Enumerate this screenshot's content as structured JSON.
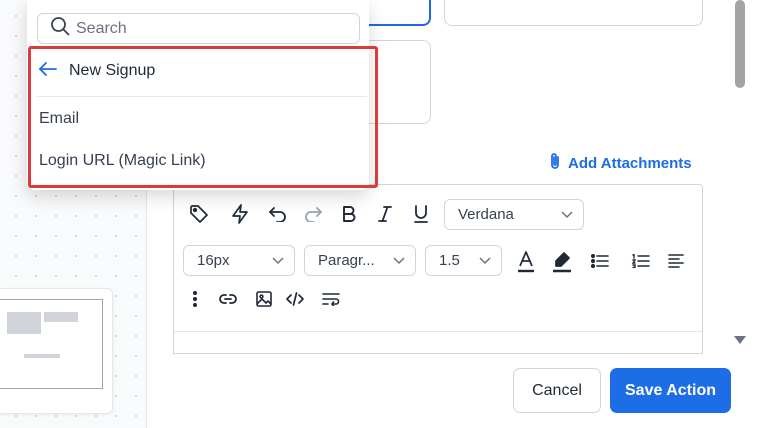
{
  "dropdown": {
    "search_placeholder": "Search",
    "back_label": "New Signup",
    "items": [
      {
        "label": "Email"
      },
      {
        "label": "Login URL (Magic Link)"
      }
    ]
  },
  "attachments": {
    "label": "Add Attachments"
  },
  "editor": {
    "font_family": "Verdana",
    "font_size": "16px",
    "block_format": "Paragr...",
    "line_height": "1.5",
    "tools_row1": [
      "tag-icon",
      "lightning-icon",
      "undo-icon",
      "redo-icon",
      "bold-icon",
      "italic-icon",
      "underline-icon"
    ],
    "tools_row2": [
      "text-color-icon",
      "highlight-icon",
      "bullet-list-icon",
      "numbered-list-icon",
      "align-left-icon"
    ],
    "tools_row3": [
      "more-vertical-icon",
      "link-icon",
      "image-icon",
      "code-icon",
      "wrap-text-icon"
    ]
  },
  "footer": {
    "cancel_label": "Cancel",
    "save_label": "Save Action"
  },
  "colors": {
    "accent": "#1d6ee6",
    "highlight_border": "#dc3b3b"
  }
}
